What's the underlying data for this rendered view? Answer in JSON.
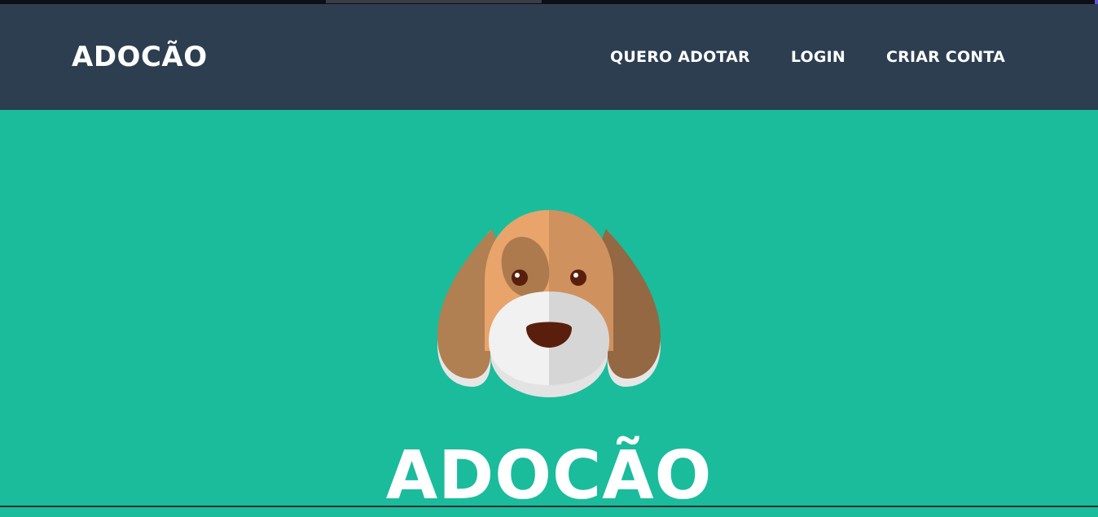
{
  "navbar": {
    "brand": "ADOCÃO",
    "links": [
      {
        "label": "QUERO ADOTAR"
      },
      {
        "label": "LOGIN"
      },
      {
        "label": "CRIAR CONTA"
      }
    ]
  },
  "hero": {
    "image": "dog-face-icon",
    "title": "ADOCÃO"
  },
  "colors": {
    "navbar_bg": "#2c3e50",
    "hero_bg": "#1abc9c",
    "text": "#ffffff"
  }
}
